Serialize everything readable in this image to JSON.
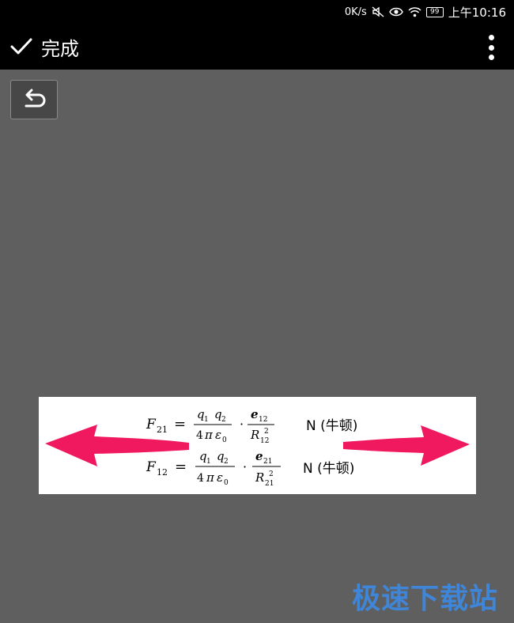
{
  "status_bar": {
    "net_speed": "0K/s",
    "battery": "99",
    "time": "上午10:16",
    "icons": [
      "mute-icon",
      "eye-icon",
      "wifi-icon",
      "battery-icon"
    ]
  },
  "toolbar": {
    "done_label": "完成",
    "done_icon": "checkmark-icon",
    "more_icon": "more-vertical-icon"
  },
  "undo_icon": "undo-icon",
  "image": {
    "formula1": {
      "lhs": "F",
      "lhs_sub": "21",
      "num_a": "q",
      "num_a_sub": "1",
      "num_b": "q",
      "num_b_sub": "2",
      "den_coef": "4",
      "den_pi": "π",
      "den_eps": "ε",
      "den_eps_sub": "0",
      "unit_vec": "e",
      "unit_vec_sub": "12",
      "r": "R",
      "r_sup": "2",
      "r_sub": "12",
      "unit": "N (牛顿)"
    },
    "formula2": {
      "lhs": "F",
      "lhs_sub": "12",
      "num_a": "q",
      "num_a_sub": "1",
      "num_b": "q",
      "num_b_sub": "2",
      "den_coef": "4",
      "den_pi": "π",
      "den_eps": "ε",
      "den_eps_sub": "0",
      "unit_vec": "e",
      "unit_vec_sub": "21",
      "r": "R",
      "r_sup": "2",
      "r_sub": "21",
      "unit": "N (牛顿)"
    },
    "arrow_color": "#f0185e"
  },
  "watermark": "极速下载站"
}
